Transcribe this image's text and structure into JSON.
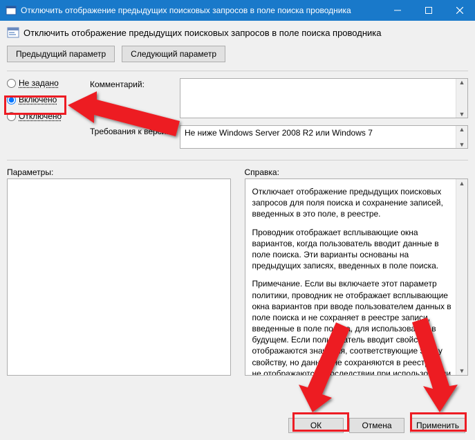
{
  "titlebar": {
    "title": "Отключить отображение предыдущих поисковых запросов в поле поиска проводника"
  },
  "header": {
    "title": "Отключить отображение предыдущих поисковых запросов в поле поиска проводника"
  },
  "nav": {
    "prev": "Предыдущий параметр",
    "next": "Следующий параметр"
  },
  "radios": {
    "not_configured": "Не задано",
    "enabled": "Включено",
    "disabled": "Отключено",
    "selected": "enabled"
  },
  "fields": {
    "comment_label": "Комментарий:",
    "comment_value": "",
    "supported_label": "Требования к версии:",
    "supported_value": "Не ниже Windows Server 2008 R2 или Windows 7"
  },
  "panels": {
    "options_label": "Параметры:",
    "help_label": "Справка:"
  },
  "help": {
    "p1": "Отключает отображение предыдущих поисковых запросов для поля поиска и сохранение записей, введенных в это поле, в реестре.",
    "p2": "Проводник отображает всплывающие окна вариантов, когда пользователь вводит данные в поле поиска.  Эти варианты основаны на предыдущих записях, введенных в поле поиска.",
    "p3": "Примечание. Если вы включаете этот параметр политики, проводник не отображает всплывающие окна вариантов при вводе пользователем данных в поле поиска и не сохраняет в реестре записи, введенные в поле поиска, для использования в будущем.  Если пользователь вводит свойство, отображаются значения, соответствующие этому свойству, но данные не сохраняются в реестре и не отображаются впоследствии при использовании поля поиска."
  },
  "buttons": {
    "ok": "ОК",
    "cancel": "Отмена",
    "apply": "Применить"
  },
  "icons": {
    "window": "window-icon",
    "minimize": "minimize-icon",
    "maximize": "maximize-icon",
    "close": "close-icon"
  }
}
